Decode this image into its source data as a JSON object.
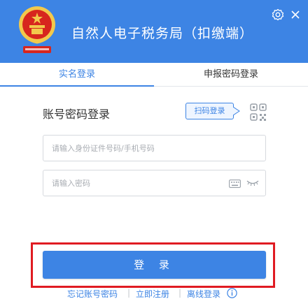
{
  "header": {
    "title": "自然人电子税务局（扣缴端）",
    "logo_icon": "tax-emblem",
    "settings_icon": "gear-icon",
    "close_icon": "close-icon",
    "background": "#3d84e4"
  },
  "tabs": [
    {
      "label": "实名登录",
      "active": true
    },
    {
      "label": "申报密码登录",
      "active": false
    }
  ],
  "login": {
    "heading": "账号密码登录",
    "scan_label": "扫码登录",
    "id_placeholder": "请输入身份证件号码/手机号码",
    "id_value": "",
    "password_placeholder": "请输入密码",
    "password_value": "",
    "submit_label": "登 录"
  },
  "footer": {
    "forgot_label": "忘记账号密码",
    "register_label": "立即注册",
    "offline_label": "离线登录",
    "separator": "|"
  },
  "colors": {
    "accent": "#3d84e4",
    "highlight": "#e01b22"
  }
}
